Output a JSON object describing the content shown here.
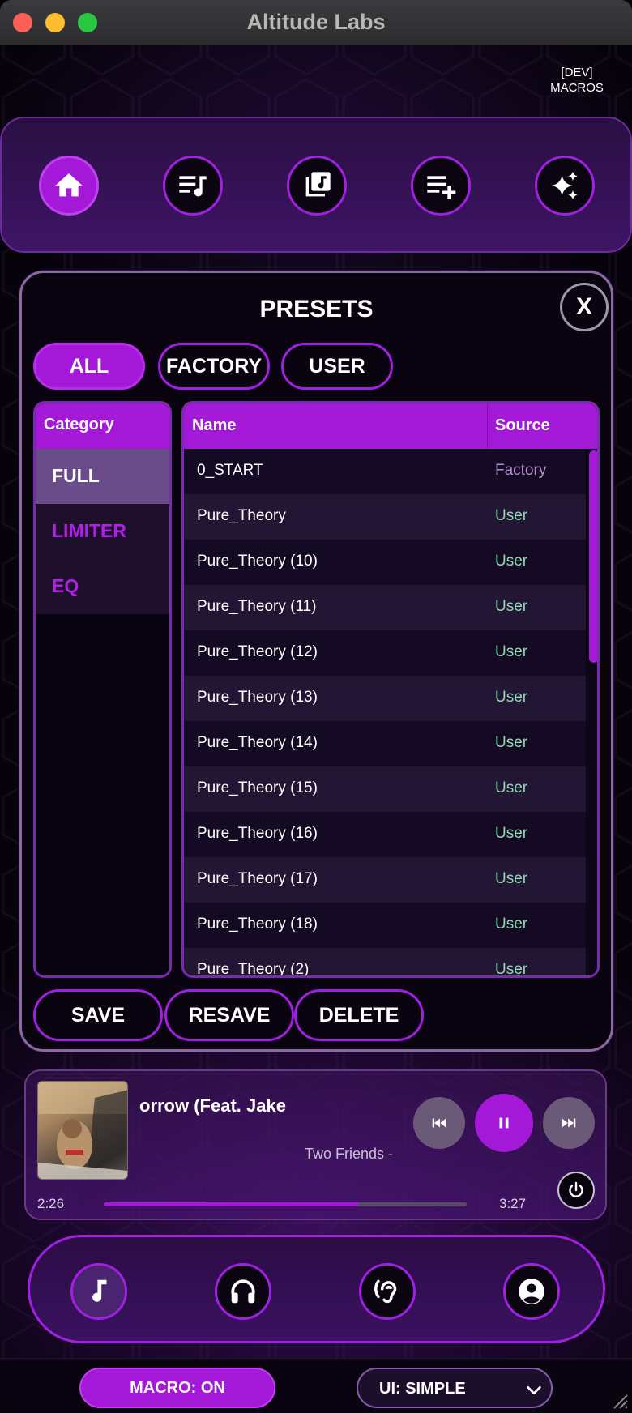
{
  "window": {
    "title": "Altitude Labs"
  },
  "dev": {
    "line1": "[DEV]",
    "line2": "MACROS"
  },
  "top_nav": {
    "items": [
      {
        "name": "home",
        "icon": "home-icon",
        "active": true
      },
      {
        "name": "playlist",
        "icon": "music-list-icon",
        "active": false
      },
      {
        "name": "library",
        "icon": "music-library-icon",
        "active": false
      },
      {
        "name": "add-to-queue",
        "icon": "playlist-add-icon",
        "active": false
      },
      {
        "name": "sparkles",
        "icon": "sparkles-icon",
        "active": false
      }
    ]
  },
  "presets": {
    "title": "PRESETS",
    "close_label": "X",
    "filters": [
      {
        "label": "ALL",
        "active": true
      },
      {
        "label": "FACTORY",
        "active": false
      },
      {
        "label": "USER",
        "active": false
      }
    ],
    "category_header": "Category",
    "categories": [
      {
        "label": "FULL",
        "selected": true
      },
      {
        "label": "LIMITER",
        "selected": false
      },
      {
        "label": "EQ",
        "selected": false
      }
    ],
    "columns": {
      "name": "Name",
      "source": "Source"
    },
    "rows": [
      {
        "name": "0_START",
        "source": "Factory"
      },
      {
        "name": "Pure_Theory",
        "source": "User"
      },
      {
        "name": "Pure_Theory (10)",
        "source": "User"
      },
      {
        "name": "Pure_Theory (11)",
        "source": "User"
      },
      {
        "name": "Pure_Theory (12)",
        "source": "User"
      },
      {
        "name": "Pure_Theory (13)",
        "source": "User"
      },
      {
        "name": "Pure_Theory (14)",
        "source": "User"
      },
      {
        "name": "Pure_Theory (15)",
        "source": "User"
      },
      {
        "name": "Pure_Theory (16)",
        "source": "User"
      },
      {
        "name": "Pure_Theory (17)",
        "source": "User"
      },
      {
        "name": "Pure_Theory (18)",
        "source": "User"
      },
      {
        "name": "Pure_Theory (2)",
        "source": "User"
      }
    ],
    "actions": {
      "save": "SAVE",
      "resave": "RESAVE",
      "delete": "DELETE"
    }
  },
  "player": {
    "track_title": "orrow (Feat. Jake",
    "artist": "Two Friends -",
    "elapsed": "2:26",
    "duration": "3:27",
    "progress": 0.7,
    "state": "playing"
  },
  "bottom_nav": {
    "items": [
      {
        "name": "music",
        "icon": "music-note-icon",
        "active": true
      },
      {
        "name": "headphones",
        "icon": "headphones-icon",
        "active": false
      },
      {
        "name": "hearing",
        "icon": "hearing-icon",
        "active": false
      },
      {
        "name": "account",
        "icon": "account-icon",
        "active": false
      }
    ]
  },
  "footer": {
    "macro_label": "MACRO: ON",
    "ui_mode_label": "UI: SIMPLE"
  },
  "colors": {
    "accent": "#a419d8",
    "source_factory": "#b58fd0",
    "source_user": "#8fd8b0",
    "category_text": "#b21fe6"
  }
}
